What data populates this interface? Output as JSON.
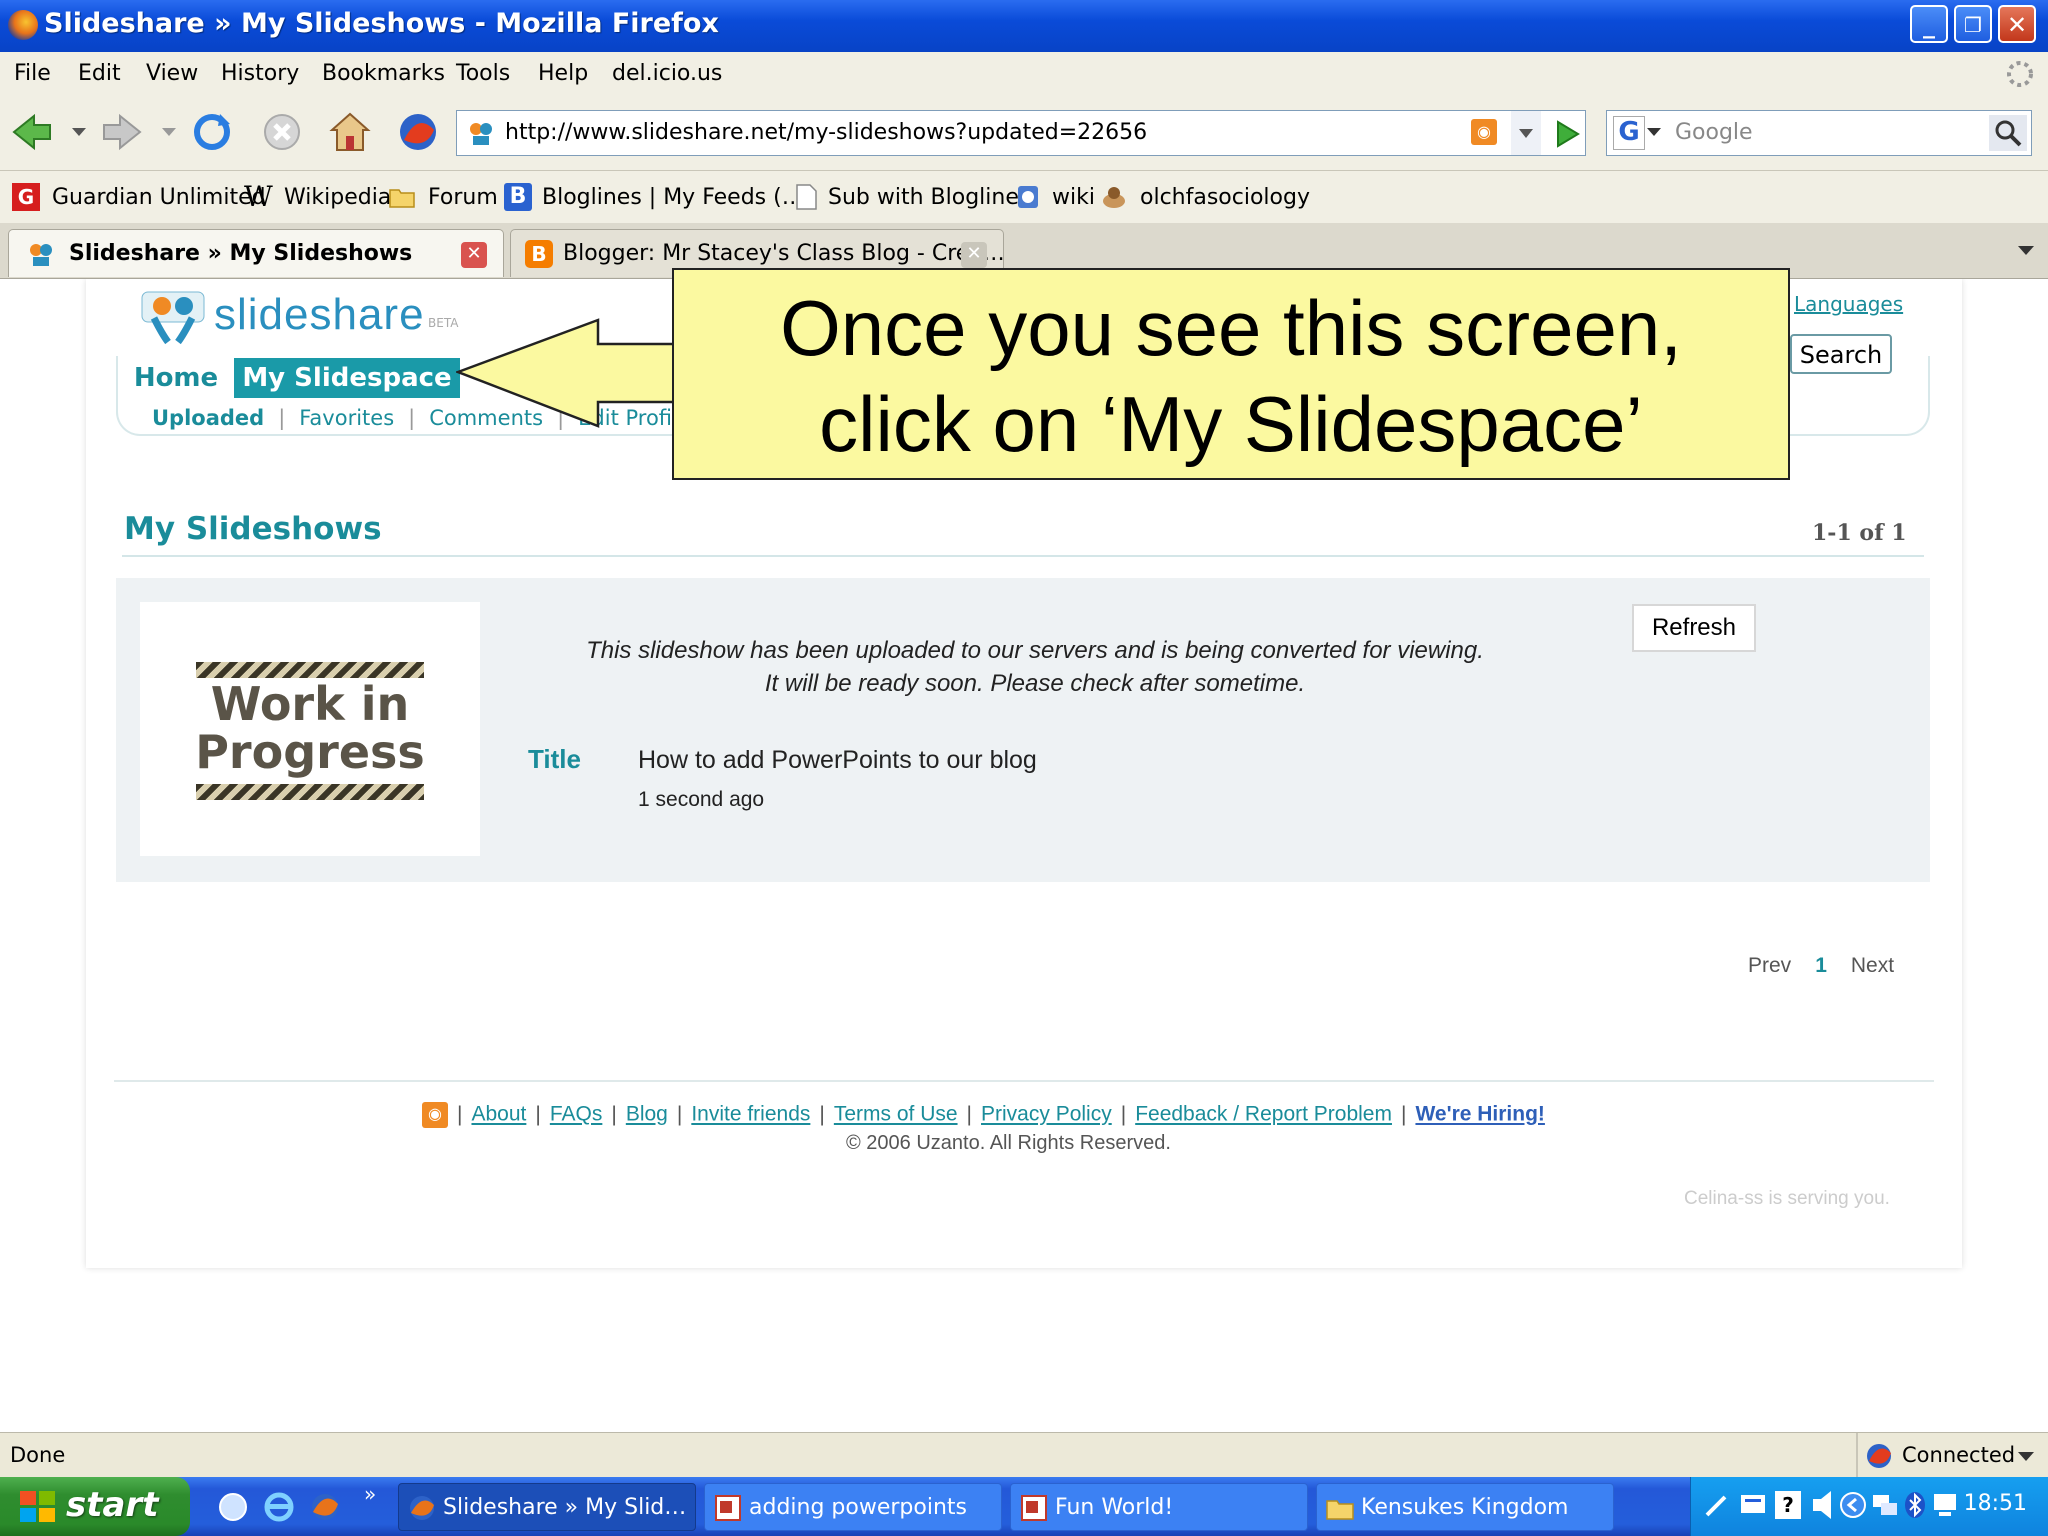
{
  "window": {
    "title": "Slideshare » My Slideshows - Mozilla Firefox",
    "minimize": "_",
    "maximize": "❐",
    "close": "✕"
  },
  "menu": [
    "File",
    "Edit",
    "View",
    "History",
    "Bookmarks",
    "Tools",
    "Help",
    "del.icio.us"
  ],
  "navbar": {
    "url": "http://www.slideshare.net/my-slideshows?updated=22656",
    "search_placeholder": "Google"
  },
  "bookmarks": [
    "Guardian Unlimited",
    "Wikipedia",
    "Forum",
    "Bloglines | My Feeds (…",
    "Sub with Bloglines",
    "wiki",
    "olchfasociology"
  ],
  "tabs": [
    {
      "label": "Slideshare » My Slideshows",
      "active": true
    },
    {
      "label": "Blogger: Mr Stacey's Class Blog - Crea…",
      "active": false
    }
  ],
  "site": {
    "logo_text": "slideshare",
    "logo_beta": "BETA",
    "nav": {
      "home": "Home",
      "my_slidespace": "My Slidespace"
    },
    "subnav": {
      "uploaded": "Uploaded",
      "favorites": "Favorites",
      "comments": "Comments",
      "edit_profile": "Edit Profile"
    },
    "languages_link": "Languages",
    "search_button": "Search"
  },
  "callout": {
    "line1": "Once you see this screen,",
    "line2": "click on ‘My Slidespace’"
  },
  "my_slideshows": {
    "heading": "My Slideshows",
    "count": "1-1 of 1",
    "thumbnail": {
      "line1": "Work in",
      "line2": "Progress"
    },
    "message_line1": "This slideshow has been uploaded to our servers and is being converted for viewing.",
    "message_line2": "It will be ready soon. Please check after sometime.",
    "refresh_button": "Refresh",
    "title_label": "Title",
    "title_value": "How to add PowerPoints to our blog",
    "time": "1 second ago"
  },
  "pager": {
    "prev": "Prev",
    "current": "1",
    "next": "Next"
  },
  "footer": {
    "links": [
      "About",
      "FAQs",
      "Blog",
      "Invite friends",
      "Terms of Use",
      "Privacy Policy",
      "Feedback / Report Problem"
    ],
    "hiring": "We're Hiring!",
    "copyright": "© 2006 Uzanto. All Rights Reserved.",
    "serving": "Celina-ss is serving you."
  },
  "status": {
    "left": "Done",
    "right": "Connected"
  },
  "taskbar": {
    "start": "start",
    "items": [
      "Slideshare » My Slid…",
      "adding powerpoints",
      "Fun World!",
      "Kensukes Kingdom"
    ],
    "clock": "18:51"
  },
  "colors": {
    "accent_teal": "#1a8c9a",
    "callout_bg": "#fbf9a0",
    "xp_blue": "#245edb"
  }
}
